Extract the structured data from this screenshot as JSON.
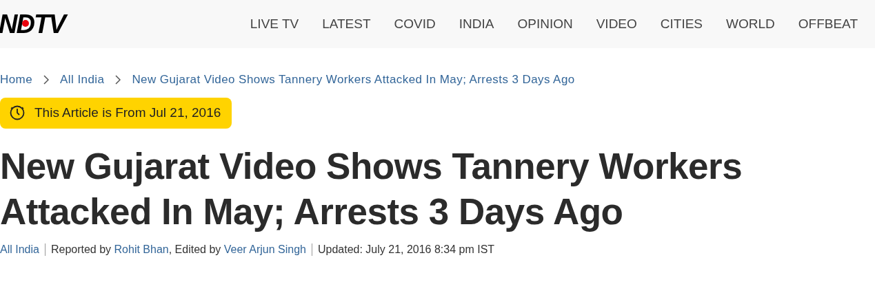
{
  "header": {
    "logo": "NDTV",
    "nav": [
      {
        "label": "LIVE TV"
      },
      {
        "label": "LATEST"
      },
      {
        "label": "COVID"
      },
      {
        "label": "INDIA"
      },
      {
        "label": "OPINION"
      },
      {
        "label": "VIDEO"
      },
      {
        "label": "CITIES"
      },
      {
        "label": "WORLD"
      },
      {
        "label": "OFFBEAT"
      }
    ]
  },
  "breadcrumb": [
    "Home",
    "All India",
    "New Gujarat Video Shows Tannery Workers Attacked In May; Arrests 3 Days Ago"
  ],
  "archive_badge": "This Article is From Jul 21, 2016",
  "headline": "New Gujarat Video Shows Tannery Workers Attacked In May; Arrests 3 Days Ago",
  "meta": {
    "category": "All India",
    "byline": [
      {
        "kind": "text",
        "text": "Reported by "
      },
      {
        "kind": "link",
        "text": "Rohit Bhan"
      },
      {
        "kind": "text",
        "text": ", Edited by "
      },
      {
        "kind": "link",
        "text": "Veer Arjun Singh"
      }
    ],
    "updated": "Updated: July 21, 2016 8:34 pm IST"
  }
}
